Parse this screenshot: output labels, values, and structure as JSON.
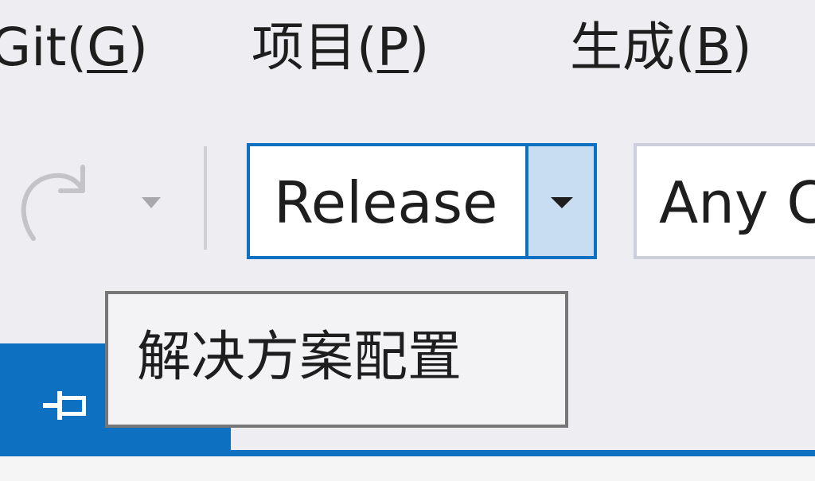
{
  "menu": {
    "items": [
      {
        "label": "Git(",
        "mnemonic": "G",
        "suffix": ")"
      },
      {
        "label": "项目(",
        "mnemonic": "P",
        "suffix": ")"
      },
      {
        "label": "生成(",
        "mnemonic": "B",
        "suffix": ")"
      }
    ]
  },
  "toolbar": {
    "redo_icon": "redo-icon",
    "solution_configuration": {
      "value": "Release"
    },
    "solution_platform": {
      "value": "Any C"
    }
  },
  "tooltip": {
    "text": "解决方案配置"
  },
  "tab": {
    "pin_icon": "pin-icon"
  },
  "colors": {
    "accent": "#0e70c0",
    "background": "#eeeef2",
    "dropdown_highlight": "#c8dcf2"
  }
}
